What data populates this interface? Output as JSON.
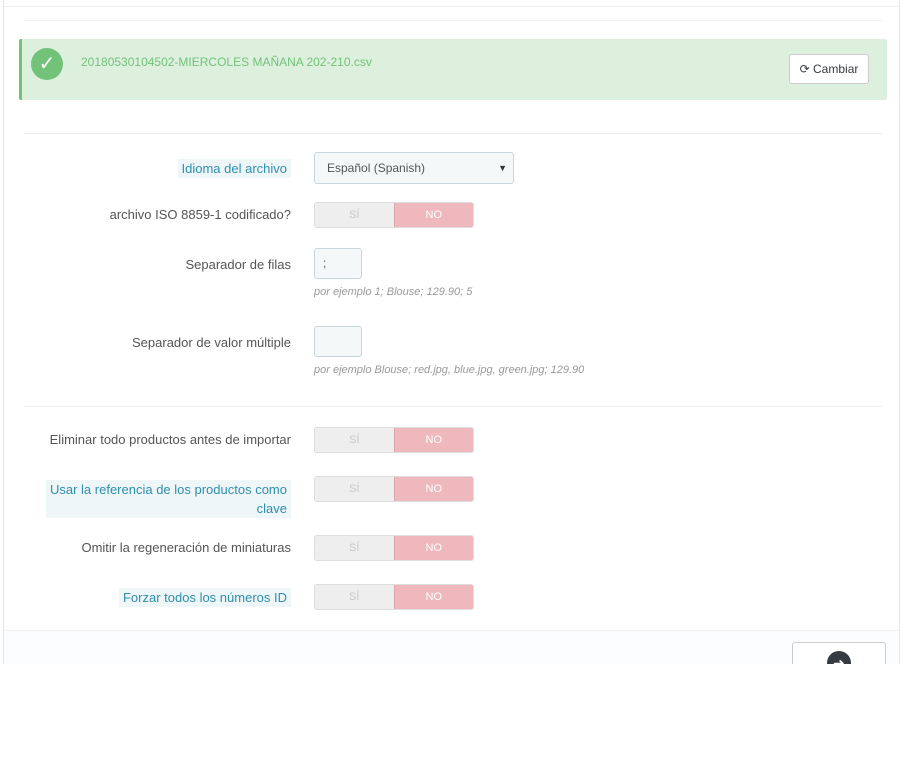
{
  "alert": {
    "filename": "20180530104502-MIERCOLES MAÑANA 202-210.csv",
    "change_button": "Cambiar",
    "icon": "check-circle-icon",
    "color": "#72c279"
  },
  "form": {
    "language": {
      "label": "Idioma del archivo",
      "value": "Español (Spanish)"
    },
    "iso": {
      "label": "archivo ISO 8859-1 codificado?",
      "yes": "SÍ",
      "no": "NO",
      "selected": "NO"
    },
    "row_separator": {
      "label": "Separador de filas",
      "value": ";",
      "help": "por ejemplo 1; Blouse; 129.90; 5"
    },
    "multi_separator": {
      "label": "Separador de valor múltiple",
      "value": "",
      "help": "por ejemplo Blouse; red.jpg, blue.jpg, green.jpg; 129.90"
    },
    "delete_products": {
      "label": "Eliminar todo productos antes de importar",
      "yes": "SÍ",
      "no": "NO",
      "selected": "NO"
    },
    "use_reference": {
      "label_line1": "Usar la referencia de los productos como",
      "label_line2": "clave",
      "yes": "SÍ",
      "no": "NO",
      "selected": "NO"
    },
    "skip_thumbnails": {
      "label": "Omitir la regeneración de miniaturas",
      "yes": "SÍ",
      "no": "NO",
      "selected": "NO"
    },
    "force_ids": {
      "label": "Forzar todos los números ID",
      "yes": "SÍ",
      "no": "NO",
      "selected": "NO"
    }
  },
  "footer": {
    "next_icon": "arrow-right-circle-icon"
  },
  "colors": {
    "switch_no": "#eeb8bd",
    "accent": "#2e8fae"
  }
}
